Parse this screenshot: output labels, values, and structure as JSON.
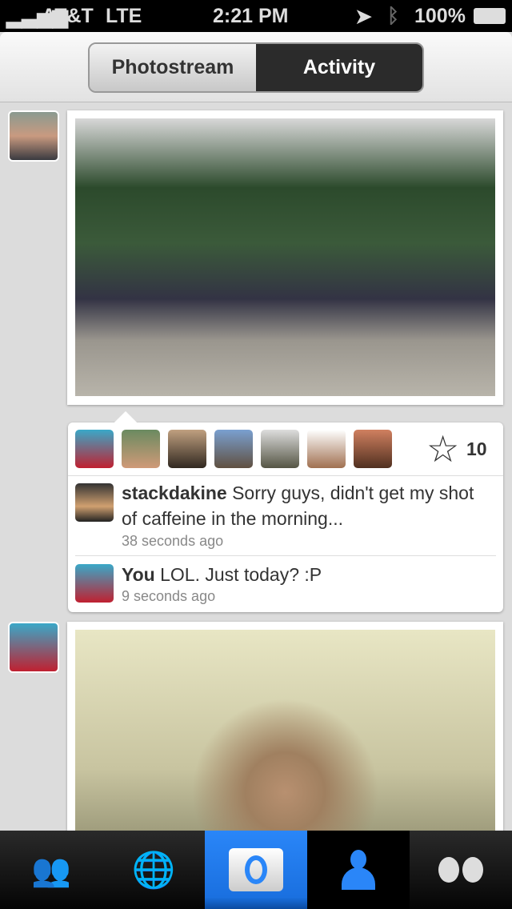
{
  "status": {
    "carrier": "AT&T",
    "network": "LTE",
    "time": "2:21 PM",
    "battery": "100%"
  },
  "nav": {
    "segments": [
      {
        "label": "Photostream",
        "selected": false
      },
      {
        "label": "Activity",
        "selected": true
      }
    ]
  },
  "posts": [
    {
      "likes_count": "10",
      "comments": [
        {
          "user": "stackdakine",
          "text": " Sorry guys, didn't get my shot of caffeine in the morning...",
          "time": "38 seconds ago"
        },
        {
          "user": "You",
          "text": " LOL. Just today? :P",
          "time": "9 seconds ago"
        }
      ]
    }
  ],
  "tabs": [
    "contacts-icon",
    "globe-icon",
    "camera-icon",
    "profile-icon",
    "flickr-icon"
  ],
  "colors": {
    "accent": "#2a86f8"
  }
}
